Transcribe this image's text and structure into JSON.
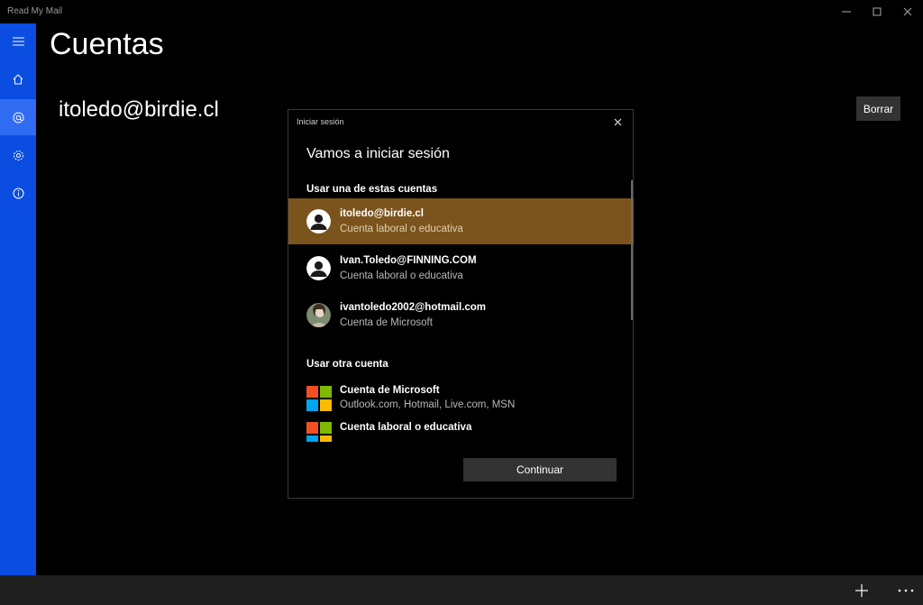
{
  "window": {
    "title": "Read My Mail",
    "icons": [
      "minimize-icon",
      "maximize-icon",
      "close-icon"
    ]
  },
  "sidebar": {
    "items": [
      {
        "icon": "hamburger-menu-icon"
      },
      {
        "icon": "home-icon"
      },
      {
        "icon": "at-sign-icon",
        "active": true
      },
      {
        "icon": "gear-icon"
      },
      {
        "icon": "info-icon"
      }
    ],
    "color": "#0a4de0"
  },
  "main": {
    "title": "Cuentas",
    "account": "itoledo@birdie.cl",
    "delete_label": "Borrar"
  },
  "dialog": {
    "title": "Iniciar sesión",
    "heading": "Vamos a iniciar sesión",
    "section_existing": "Usar una de estas cuentas",
    "accounts": [
      {
        "email": "itoledo@birdie.cl",
        "type": "Cuenta laboral o educativa",
        "selected": true
      },
      {
        "email": "Ivan.Toledo@FINNING.COM",
        "type": "Cuenta laboral o educativa"
      },
      {
        "email": "ivantoledo2002@hotmail.com",
        "type": "Cuenta de Microsoft"
      }
    ],
    "section_other": "Usar otra cuenta",
    "other_accounts": [
      {
        "name": "Cuenta de Microsoft",
        "detail": "Outlook.com, Hotmail, Live.com, MSN"
      },
      {
        "name": "Cuenta laboral o educativa",
        "detail": ""
      }
    ],
    "continue_label": "Continuar",
    "accent": "#7a541c"
  },
  "bottombar": {
    "icons": [
      "add-icon",
      "more-icon"
    ]
  }
}
